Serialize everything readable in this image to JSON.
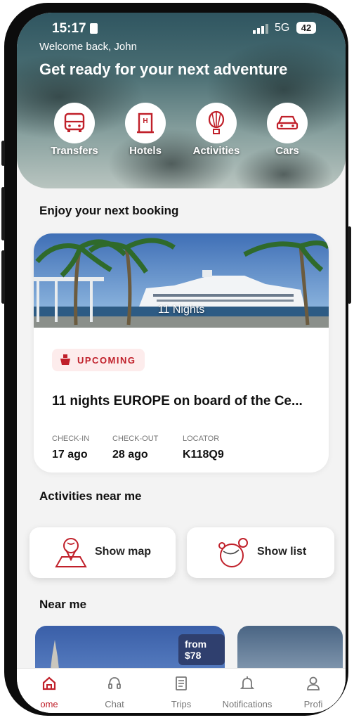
{
  "status_bar": {
    "time": "15:17",
    "network": "5G",
    "battery": "42"
  },
  "header": {
    "welcome": "Welcome back, John",
    "headline": "Get ready for your next adventure"
  },
  "quick_actions": [
    {
      "label": "Transfers",
      "icon": "bus-icon"
    },
    {
      "label": "Hotels",
      "icon": "hotel-icon"
    },
    {
      "label": "Activities",
      "icon": "hot-air-balloon-icon"
    },
    {
      "label": "Cars",
      "icon": "car-icon"
    }
  ],
  "booking_section": {
    "title": "Enjoy your next booking",
    "card": {
      "nights_overlay": "11 Nights",
      "status_badge": "UPCOMING",
      "title": "11 nights EUROPE on board of the Ce...",
      "checkin_label": "CHECK-IN",
      "checkin_value": "17 ago",
      "checkout_label": "CHECK-OUT",
      "checkout_value": "28 ago",
      "locator_label": "LOCATOR",
      "locator_value": "K118Q9"
    }
  },
  "activities_section": {
    "title": "Activities near me",
    "show_map": "Show map",
    "show_list": "Show list"
  },
  "near_section": {
    "title": "Near me",
    "price_badge": "from $78"
  },
  "tab_bar": {
    "tabs": [
      {
        "label": "ome",
        "icon": "home-icon",
        "active": true
      },
      {
        "label": "Chat",
        "icon": "headset-icon"
      },
      {
        "label": "Trips",
        "icon": "document-icon"
      },
      {
        "label": "Notifications",
        "icon": "bell-icon"
      },
      {
        "label": "Profi",
        "icon": "user-icon"
      }
    ]
  },
  "colors": {
    "accent": "#c0202a",
    "price_badge_bg": "#2f3f6e"
  }
}
